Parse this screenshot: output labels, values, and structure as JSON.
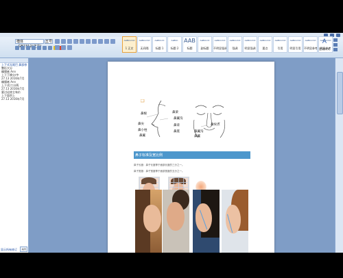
{
  "ribbon": {
    "font_name": "楷体_GB2312(正文)",
    "font_size": "五号",
    "styles": [
      {
        "sample": "AaBbCcDd",
        "name": "1 正文",
        "selected": true
      },
      {
        "sample": "AaBbCcDd",
        "name": "无间隔",
        "selected": false
      },
      {
        "sample": "AaBbCcD",
        "name": "标题 1",
        "selected": false
      },
      {
        "sample": "AaBbC",
        "name": "标题 2",
        "selected": false
      },
      {
        "sample": "AAB",
        "name": "标题",
        "selected": false
      },
      {
        "sample": "AaBbCcD",
        "name": "副标题",
        "selected": false
      },
      {
        "sample": "AaBbCcDd",
        "name": "不明显强调",
        "selected": false
      },
      {
        "sample": "AaBbCcDd",
        "name": "强调",
        "selected": false
      },
      {
        "sample": "AaBbCcDd",
        "name": "明显强调",
        "selected": false
      },
      {
        "sample": "AaBbCcDd",
        "name": "要点",
        "selected": false
      },
      {
        "sample": "AaBbCcDd",
        "name": "引用",
        "selected": false
      },
      {
        "sample": "AaBbCcDd",
        "name": "明显引用",
        "selected": false
      },
      {
        "sample": "AaBbCcDd",
        "name": "不明显参考",
        "selected": false
      },
      {
        "sample": "AaBbCcDd",
        "name": "明显参考",
        "selected": false
      }
    ],
    "edit_label": "更改样式",
    "edit_icon": "styles-A-icon"
  },
  "nav": {
    "items": [
      {
        "text": "上下式无尾巴 鼻部修",
        "link": true
      },
      {
        "text": "整形大分",
        "link": false
      },
      {
        "text": "",
        "link": false
      },
      {
        "text": "编辑者 Ann",
        "link": false
      },
      {
        "text": "上下下降分/中",
        "link": false
      },
      {
        "text": "27.13 2016年7月",
        "link": false
      },
      {
        "text": "",
        "link": false
      },
      {
        "text": "编辑者 Ann",
        "link": false
      },
      {
        "text": "上下式/二分两",
        "link": false
      },
      {
        "text": "27.13 2016年7月",
        "link": false
      },
      {
        "text": "",
        "link": false
      },
      {
        "text": "要讨论修立有价",
        "link": false
      },
      {
        "text": "上下面积上",
        "link": false
      },
      {
        "text": "27.13 2016年7月",
        "link": false
      }
    ],
    "footer": "显示所有修订",
    "footer_btn": "关闭"
  },
  "document": {
    "annotations": [
      "鼻根",
      "鼻梁",
      "鼻尖",
      "鼻小柱",
      "鼻翼沟",
      "鼻翼",
      "鼻背",
      "鼻底",
      "鼻尖点",
      "鼻翼沟",
      "鼻翼"
    ],
    "section_title": "鼻子标准及宽比例",
    "lines": [
      "鼻子长度：鼻子长度等于面部长度的三分之一。",
      "鼻子宽度：鼻子宽度等于面部宽度的五分之一。"
    ],
    "ratio_label": "1：1"
  }
}
